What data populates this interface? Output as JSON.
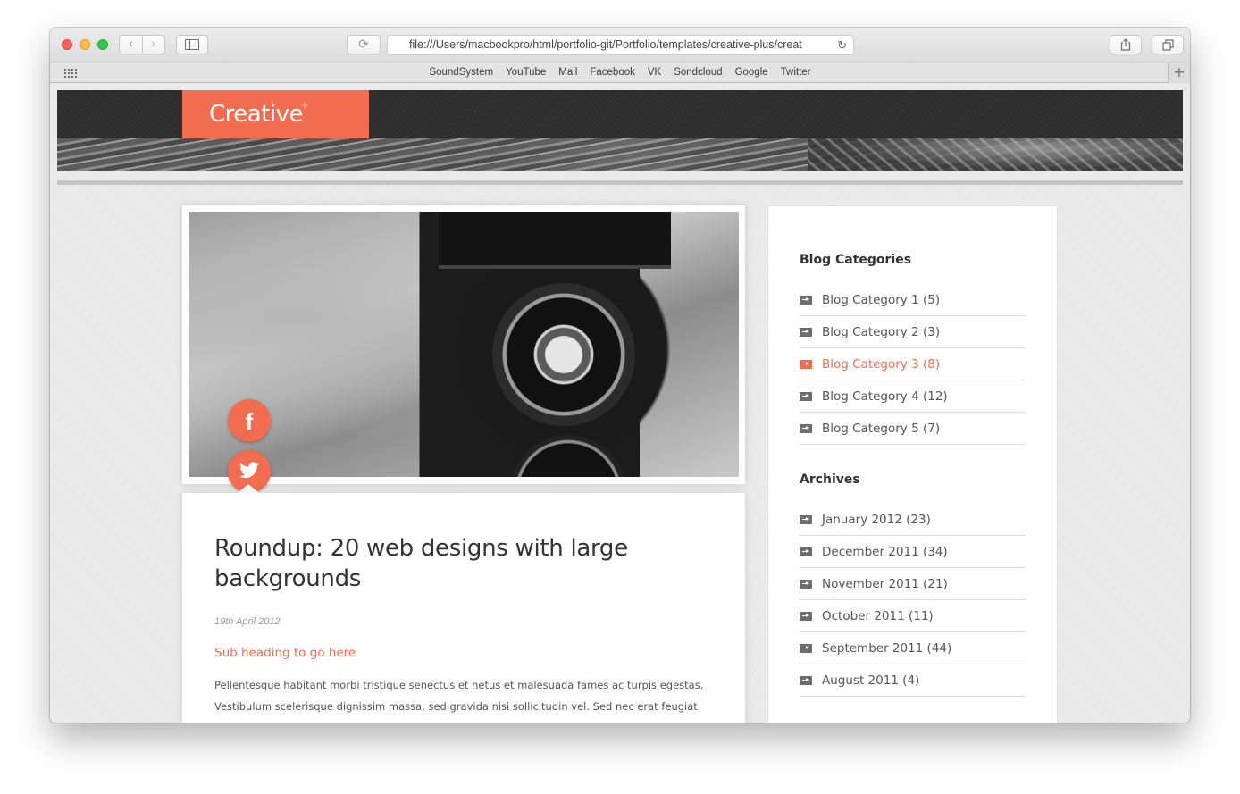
{
  "browser": {
    "url": "file:///Users/macbookpro/html/portfolio-git/Portfolio/templates/creative-plus/creat",
    "bookmarks": [
      "SoundSystem",
      "YouTube",
      "Mail",
      "Facebook",
      "VK",
      "Sondcloud",
      "Google",
      "Twitter"
    ]
  },
  "site": {
    "logo_text": "Creative",
    "logo_plus": "+"
  },
  "post": {
    "title": "Roundup: 20 web designs with large backgrounds",
    "date": "19th April 2012",
    "subheading": "Sub heading to go here",
    "body": "Pellentesque habitant morbi tristique senectus et netus et malesuada fames ac turpis egestas. Vestibulum scelerisque dignissim massa, sed gravida nisi sollicitudin vel. Sed nec erat feugiat orci",
    "social": [
      "facebook",
      "twitter"
    ]
  },
  "sidebar": {
    "categories_title": "Blog Categories",
    "categories": [
      {
        "label": "Blog Category 1 (5)",
        "active": false
      },
      {
        "label": "Blog Category 2 (3)",
        "active": false
      },
      {
        "label": "Blog Category 3 (8)",
        "active": true
      },
      {
        "label": "Blog Category 4 (12)",
        "active": false
      },
      {
        "label": "Blog Category 5 (7)",
        "active": false
      }
    ],
    "archives_title": "Archives",
    "archives": [
      {
        "label": "January 2012 (23)"
      },
      {
        "label": "December 2011 (34)"
      },
      {
        "label": "November 2011 (21)"
      },
      {
        "label": "October 2011 (11)"
      },
      {
        "label": "September 2011 (44)"
      },
      {
        "label": "August 2011 (4)"
      }
    ]
  },
  "colors": {
    "accent": "#f26c50",
    "header_dark": "#2f2f2f",
    "text": "#555555"
  }
}
